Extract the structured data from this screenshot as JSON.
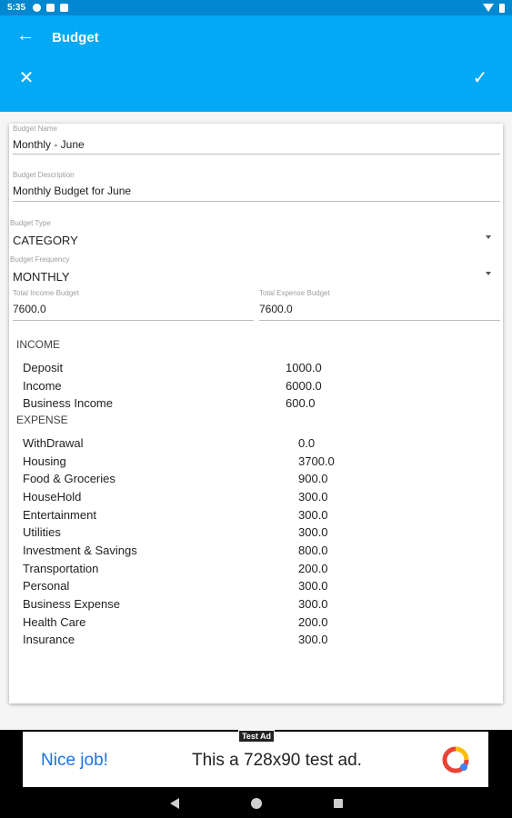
{
  "status_bar": {
    "time": "5:35"
  },
  "app_bar": {
    "title": "Budget",
    "back_icon": "arrow-left-icon",
    "close_icon": "close-icon",
    "check_icon": "check-icon",
    "color": "#03a9f4"
  },
  "form": {
    "name": {
      "label": "Budget Name",
      "value": "Monthly - June"
    },
    "description": {
      "label": "Budget Description",
      "value": "Monthly Budget for June"
    },
    "type": {
      "label": "Budget Type",
      "value": "CATEGORY"
    },
    "frequency": {
      "label": "Budget Frequency",
      "value": "MONTHLY"
    },
    "total_income": {
      "label": "Total Income Budget",
      "value": "7600.0"
    },
    "total_expense": {
      "label": "Total Expense Budget",
      "value": "7600.0"
    }
  },
  "income": {
    "header": "INCOME",
    "items": [
      {
        "name": "Deposit",
        "amount": "1000.0"
      },
      {
        "name": "Income",
        "amount": "6000.0"
      },
      {
        "name": "Business Income",
        "amount": "600.0"
      }
    ]
  },
  "expense": {
    "header": "EXPENSE",
    "items": [
      {
        "name": "WithDrawal",
        "amount": "0.0"
      },
      {
        "name": "Housing",
        "amount": "3700.0"
      },
      {
        "name": "Food & Groceries",
        "amount": "900.0"
      },
      {
        "name": "HouseHold",
        "amount": "300.0"
      },
      {
        "name": "Entertainment",
        "amount": "300.0"
      },
      {
        "name": "Utilities",
        "amount": "300.0"
      },
      {
        "name": "Investment & Savings",
        "amount": "800.0"
      },
      {
        "name": "Transportation",
        "amount": "200.0"
      },
      {
        "name": "Personal",
        "amount": "300.0"
      },
      {
        "name": "Business Expense",
        "amount": "300.0"
      },
      {
        "name": "Health Care",
        "amount": "200.0"
      },
      {
        "name": "Insurance",
        "amount": "300.0"
      }
    ]
  },
  "ad": {
    "tag": "Test Ad",
    "left_text": "Nice job!",
    "center_text": "This a 728x90 test ad."
  }
}
